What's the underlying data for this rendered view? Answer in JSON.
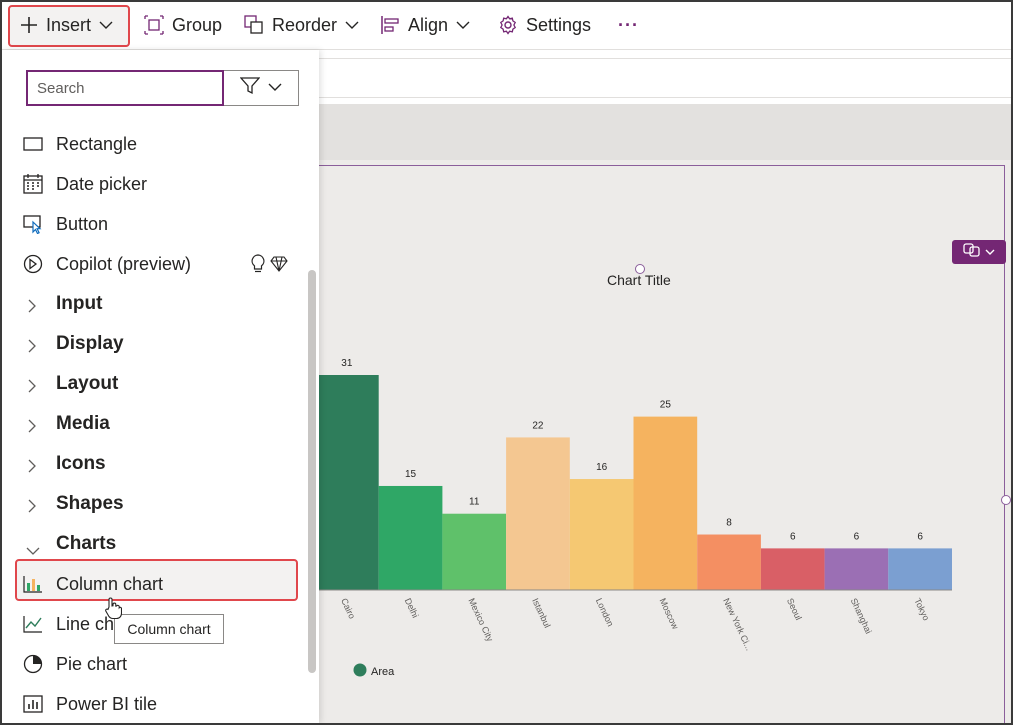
{
  "toolbar": {
    "insert": "Insert",
    "group": "Group",
    "reorder": "Reorder",
    "align": "Align",
    "settings": "Settings",
    "more": "···"
  },
  "insert_pane": {
    "search_placeholder": "Search",
    "items": [
      {
        "label": "Rectangle",
        "icon": "rectangle-icon"
      },
      {
        "label": "Date picker",
        "icon": "calendar-icon"
      },
      {
        "label": "Button",
        "icon": "button-icon"
      },
      {
        "label": "Copilot (preview)",
        "icon": "copilot-icon"
      }
    ],
    "categories": [
      "Input",
      "Display",
      "Layout",
      "Media",
      "Icons",
      "Shapes",
      "Charts"
    ],
    "charts": [
      {
        "label": "Column chart",
        "icon": "column-chart-icon"
      },
      {
        "label": "Line chart",
        "icon": "line-chart-icon"
      },
      {
        "label": "Pie chart",
        "icon": "pie-chart-icon"
      },
      {
        "label": "Power BI tile",
        "icon": "power-bi-icon"
      }
    ],
    "tooltip": "Column chart"
  },
  "colors": {
    "accent": "#742774",
    "highlight": "#e0474c"
  },
  "chart_data": {
    "type": "bar",
    "title": "Chart Title",
    "categories": [
      "Cairo",
      "Delhi",
      "Mexico City",
      "Istanbul",
      "London",
      "Moscow",
      "New York Ci...",
      "Seoul",
      "Shanghai",
      "Tokyo"
    ],
    "series": [
      {
        "name": "Area",
        "values": [
          31,
          15,
          11,
          22,
          16,
          25,
          8,
          6,
          6,
          6
        ]
      }
    ],
    "bar_colors": [
      "#2e7d5b",
      "#2fa766",
      "#5fc16a",
      "#f4c791",
      "#f5c872",
      "#f5b35f",
      "#f48f62",
      "#d95f66",
      "#9b6fb4",
      "#7b9fd1"
    ],
    "legend": "bottom-left",
    "ylim": [
      0,
      31
    ]
  }
}
